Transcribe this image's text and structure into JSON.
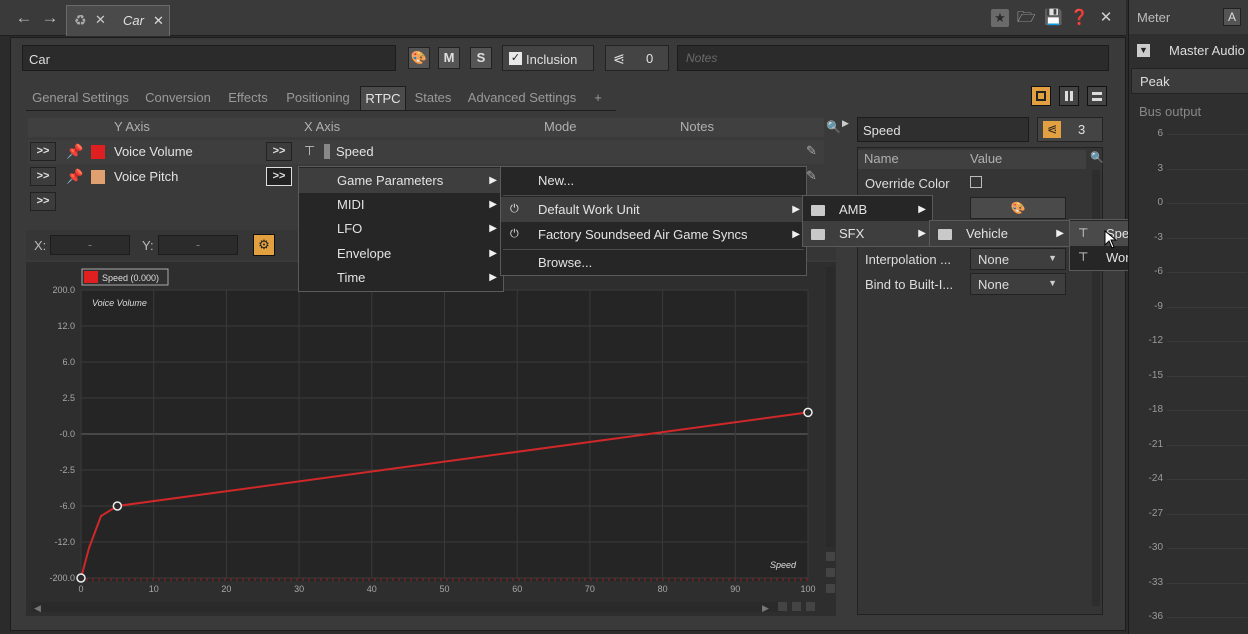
{
  "tab": {
    "title": "Car"
  },
  "object": {
    "name": "Car",
    "m_label": "M",
    "s_label": "S",
    "inclusion_label": "Inclusion",
    "count": "0",
    "notes_placeholder": "Notes"
  },
  "subtabs": [
    "General Settings",
    "Conversion",
    "Effects",
    "Positioning",
    "RTPC",
    "States",
    "Advanced Settings",
    "+"
  ],
  "rtpc_table": {
    "headers": {
      "y_axis": "Y Axis",
      "x_axis": "X Axis",
      "mode": "Mode",
      "notes": "Notes"
    },
    "rows": [
      {
        "expand": ">>",
        "name": "Voice Volume",
        "color": "#e02020",
        "xexpand": ">>",
        "x": "Speed"
      },
      {
        "expand": ">>",
        "name": "Voice Pitch",
        "color": "#e0a070",
        "xexpand": ">>",
        "x": ""
      },
      {
        "expand": ">>"
      }
    ]
  },
  "graph": {
    "x_label": "X:",
    "y_label": "Y:",
    "x_value": "-",
    "y_value": "-",
    "legend": "Speed (0.000)",
    "y_axis_title": "Voice Volume",
    "x_axis_title": "Speed",
    "y_ticks": [
      "200.0",
      "12.0",
      "6.0",
      "2.5",
      "-0.0",
      "-2.5",
      "-6.0",
      "-12.0",
      "-200.0"
    ],
    "x_ticks": [
      "0",
      "10",
      "20",
      "30",
      "40",
      "50",
      "60",
      "70",
      "80",
      "90",
      "100"
    ]
  },
  "menu1": [
    "Game Parameters",
    "MIDI",
    "LFO",
    "Envelope",
    "Time"
  ],
  "menu2": [
    "New...",
    "Default Work Unit",
    "Factory Soundseed Air Game Syncs",
    "Browse..."
  ],
  "menu3": [
    "AMB",
    "SFX"
  ],
  "menu4": [
    "Vehicle"
  ],
  "menu5": [
    "Speed",
    "Workload"
  ],
  "props": {
    "title": "Speed",
    "count": "3",
    "headers": {
      "name": "Name",
      "value": "Value"
    },
    "rows": [
      {
        "name": "Override Color",
        "value": ""
      },
      {
        "name": "Interpolation ...",
        "value": "None"
      },
      {
        "name": "Bind to Built-I...",
        "value": "None"
      }
    ]
  },
  "meter": {
    "title": "Meter",
    "a_label": "A",
    "bus": "Master Audio",
    "mode": "Peak",
    "output_label": "Bus output",
    "ticks": [
      "6",
      "3",
      "0",
      "-3",
      "-6",
      "-9",
      "-12",
      "-15",
      "-18",
      "-21",
      "-24",
      "-27",
      "-30",
      "-33",
      "-36"
    ]
  }
}
